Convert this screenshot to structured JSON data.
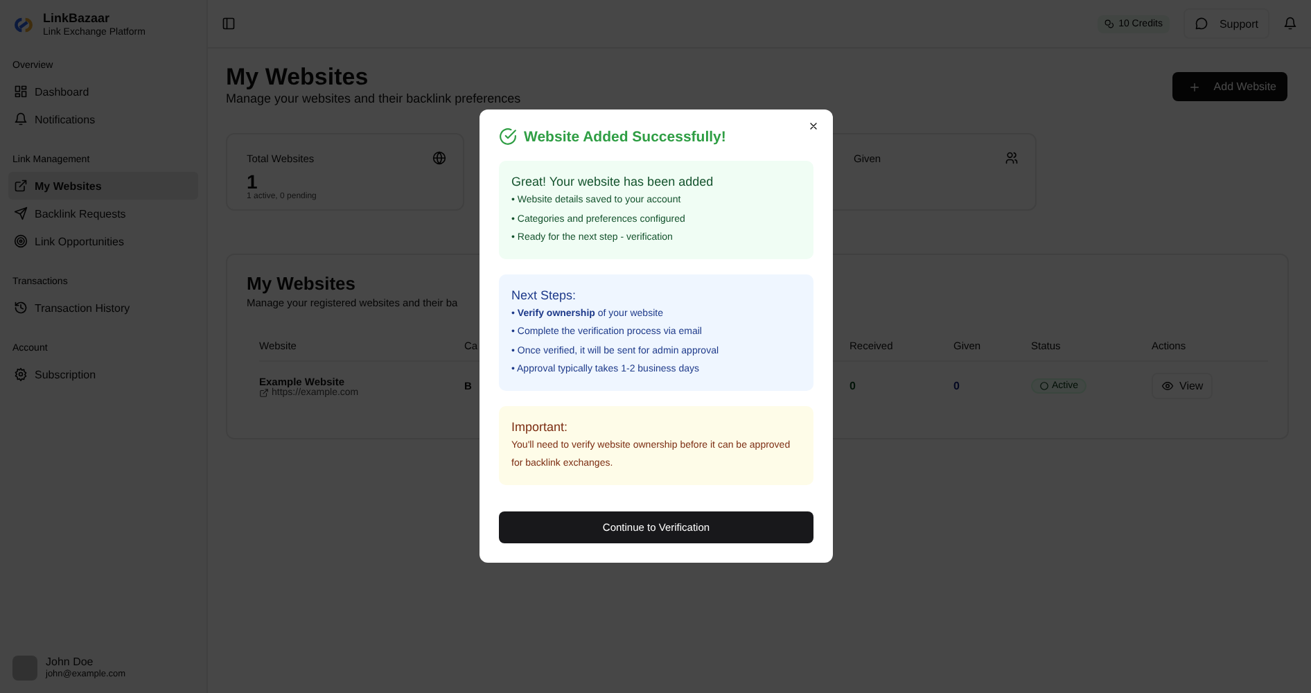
{
  "brand": {
    "name": "LinkBazaar",
    "tagline": "Link Exchange Platform"
  },
  "sidebar": {
    "sections": [
      {
        "title": "Overview",
        "items": [
          {
            "label": "Dashboard",
            "selected": false
          },
          {
            "label": "Notifications",
            "selected": false
          }
        ]
      },
      {
        "title": "Link Management",
        "items": [
          {
            "label": "My Websites",
            "selected": true
          },
          {
            "label": "Backlink Requests",
            "selected": false
          },
          {
            "label": "Link Opportunities",
            "selected": false
          }
        ]
      },
      {
        "title": "Transactions",
        "items": [
          {
            "label": "Transaction History",
            "selected": false
          }
        ]
      },
      {
        "title": "Account",
        "items": [
          {
            "label": "Subscription",
            "selected": false
          }
        ]
      }
    ]
  },
  "user": {
    "name": "John Doe",
    "email": "john@example.com"
  },
  "header": {
    "credits": "10 Credits",
    "support": "Support"
  },
  "page": {
    "title": "My Websites",
    "subtitle": "Manage your websites and their backlink preferences",
    "add_button": "Add Website"
  },
  "stats": [
    {
      "label": "Total Websites",
      "value": "1",
      "note": "1 active, 0 pending"
    },
    {
      "label": "Given"
    }
  ],
  "table_card": {
    "title": "My Websites",
    "subtitle": "Manage your registered websites and their ba"
  },
  "table": {
    "columns": [
      "Website",
      "Ca",
      "Received",
      "Given",
      "Status",
      "Actions"
    ],
    "rows": [
      {
        "name": "Example Website",
        "url": "https://example.com",
        "column_2": "B",
        "received": "0",
        "given": "0",
        "status": "Active",
        "action": "View"
      }
    ]
  },
  "modal": {
    "title": "Website Added Successfully!",
    "sections": [
      {
        "kind": "success",
        "heading": "Great! Your website has been added",
        "lines": [
          "• Website details saved to your account",
          "• Categories and preferences configured",
          "• Ready for the next step - verification"
        ]
      },
      {
        "kind": "info",
        "heading": "Next Steps:",
        "lines": [
          "• **Verify ownership** of your website",
          "• Complete the verification process via email",
          "• Once verified, it will be sent for admin approval",
          "• Approval typically takes 1-2 business days"
        ]
      },
      {
        "kind": "warning",
        "heading": "Important:",
        "lines": [
          "You'll need to verify website ownership before it can be approved for backlink exchanges."
        ]
      }
    ],
    "button": "Continue to Verification"
  }
}
